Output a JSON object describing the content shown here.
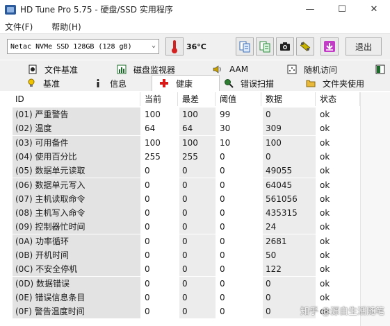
{
  "window": {
    "title": "HD Tune Pro 5.75 - 硬盘/SSD 实用程序",
    "controls": [
      "—",
      "☐",
      "✕"
    ]
  },
  "menu": [
    "文件(F)",
    "帮助(H)"
  ],
  "toolbar": {
    "drive": "Netac NVMe SSD 128GB (128 gB)",
    "temperature": "36°C",
    "exit_label": "退出",
    "tools": [
      "copy-info-icon",
      "copy-screenshot-icon",
      "camera-icon",
      "options-icon",
      "download-icon"
    ]
  },
  "tabs": {
    "row1": [
      "文件基准",
      "磁盘监视器",
      "AAM",
      "随机访问"
    ],
    "row2": [
      "基准",
      "信息",
      "健康",
      "错误扫描",
      "文件夹使用"
    ],
    "active": "健康"
  },
  "table": {
    "headers": [
      "ID",
      "当前",
      "最差",
      "阈值",
      "数据",
      "状态"
    ],
    "rows": [
      [
        "(01) 严重警告",
        "100",
        "100",
        "99",
        "0",
        "ok"
      ],
      [
        "(02) 温度",
        "64",
        "64",
        "30",
        "309",
        "ok"
      ],
      [
        "(03) 可用备件",
        "100",
        "100",
        "10",
        "100",
        "ok"
      ],
      [
        "(04) 使用百分比",
        "255",
        "255",
        "0",
        "0",
        "ok"
      ],
      [
        "(05) 数据单元读取",
        "0",
        "0",
        "0",
        "49055",
        "ok"
      ],
      [
        "(06) 数据单元写入",
        "0",
        "0",
        "0",
        "64045",
        "ok"
      ],
      [
        "(07) 主机读取命令",
        "0",
        "0",
        "0",
        "561056",
        "ok"
      ],
      [
        "(08) 主机写入命令",
        "0",
        "0",
        "0",
        "435315",
        "ok"
      ],
      [
        "(09) 控制器忙时间",
        "0",
        "0",
        "0",
        "24",
        "ok"
      ],
      [
        "(0A) 功率循环",
        "0",
        "0",
        "0",
        "2681",
        "ok"
      ],
      [
        "(0B) 开机时间",
        "0",
        "0",
        "0",
        "50",
        "ok"
      ],
      [
        "(0C) 不安全停机",
        "0",
        "0",
        "0",
        "122",
        "ok"
      ],
      [
        "(0D) 数据错误",
        "0",
        "0",
        "0",
        "0",
        "ok"
      ],
      [
        "(0E) 错误信息条目",
        "0",
        "0",
        "0",
        "0",
        "ok"
      ],
      [
        "(0F) 警告温度时间",
        "0",
        "0",
        "0",
        "0",
        "ok"
      ]
    ]
  },
  "watermark": "知乎 @源自生活随笔"
}
